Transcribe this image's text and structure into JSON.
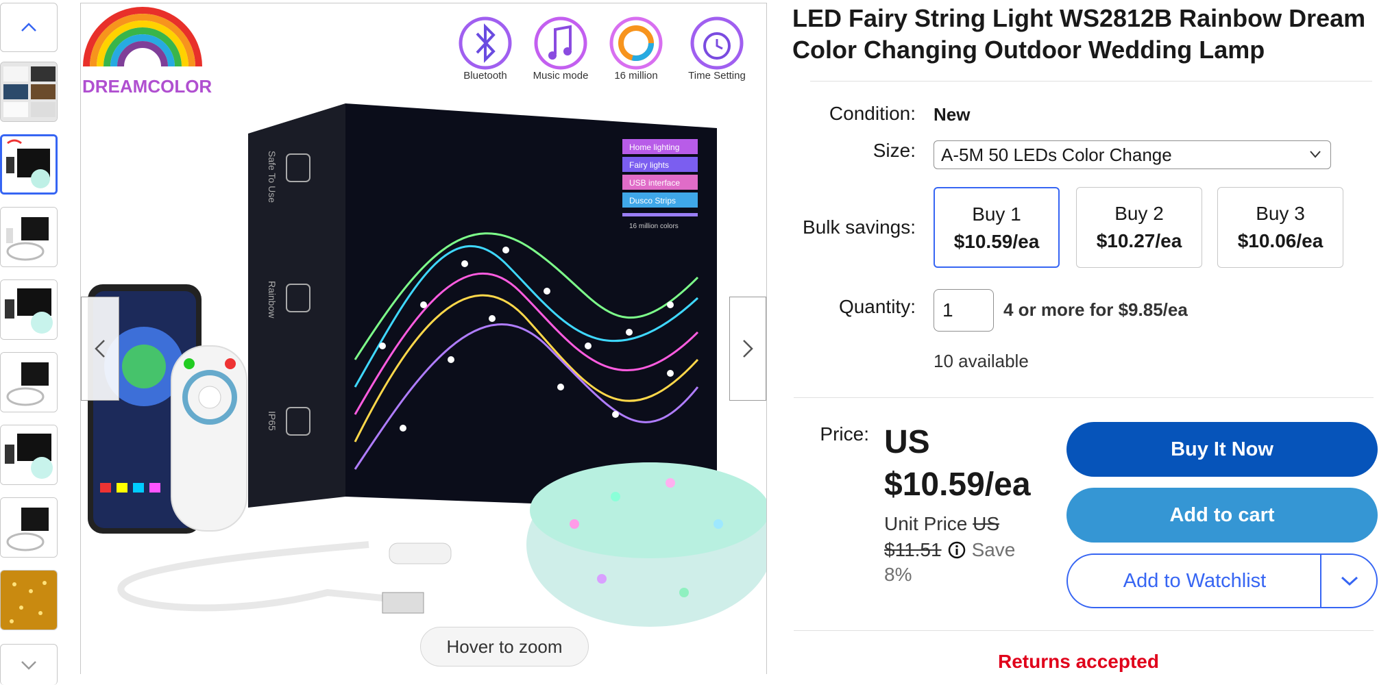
{
  "gallery": {
    "up_icon": "chevron-up-icon",
    "down_icon": "chevron-down-icon",
    "thumbnails": [
      {
        "label": "thumbnail-1",
        "selected": false
      },
      {
        "label": "thumbnail-2",
        "selected": true
      },
      {
        "label": "thumbnail-3",
        "selected": false
      },
      {
        "label": "thumbnail-4",
        "selected": false
      },
      {
        "label": "thumbnail-5",
        "selected": false
      },
      {
        "label": "thumbnail-6",
        "selected": false
      },
      {
        "label": "thumbnail-7",
        "selected": false
      },
      {
        "label": "thumbnail-8",
        "selected": false
      }
    ]
  },
  "main_image": {
    "brand_logo_text": "DREAMCOLOR",
    "features": [
      "Bluetooth",
      "Music mode",
      "16 million",
      "Time Setting"
    ],
    "box_side_labels": [
      "Safe To Use",
      "Rainbow",
      "IP65"
    ],
    "box_tags": [
      "Home lighting",
      "Fairy lights",
      "USB interface",
      "Dusco Strips"
    ],
    "box_tag_caption": "16 million colors",
    "zoom_hint": "Hover to zoom",
    "prev_icon": "chevron-left-icon",
    "next_icon": "chevron-right-icon"
  },
  "listing": {
    "title": "LED Fairy String Light WS2812B Rainbow Dream Color Changing Outdoor Wedding Lamp",
    "condition_label": "Condition:",
    "condition_value": "New",
    "size_label": "Size:",
    "size_selected": "A-5M 50 LEDs Color Change",
    "bulk_label": "Bulk savings:",
    "bulk_options": [
      {
        "title": "Buy 1",
        "price": "$10.59/ea",
        "selected": true
      },
      {
        "title": "Buy 2",
        "price": "$10.27/ea",
        "selected": false
      },
      {
        "title": "Buy 3",
        "price": "$10.06/ea",
        "selected": false
      }
    ],
    "quantity_label": "Quantity:",
    "quantity_value": "1",
    "quantity_offer": "4 or more for $9.85/ea",
    "available": "10 available",
    "price_label": "Price:",
    "price_currency": "US",
    "price_value": "$10.59/ea",
    "unit_price_label": "Unit Price",
    "was_currency": "US",
    "was_price": "$11.51",
    "save_text": "Save",
    "save_percent": "8%",
    "buy_now": "Buy It Now",
    "add_to_cart": "Add to cart",
    "add_to_watchlist": "Add to Watchlist",
    "returns": "Returns accepted"
  },
  "colors": {
    "buy_now": "#0654ba",
    "add_to_cart": "#3596d4",
    "accent": "#3665f3",
    "returns": "#e0001a"
  }
}
